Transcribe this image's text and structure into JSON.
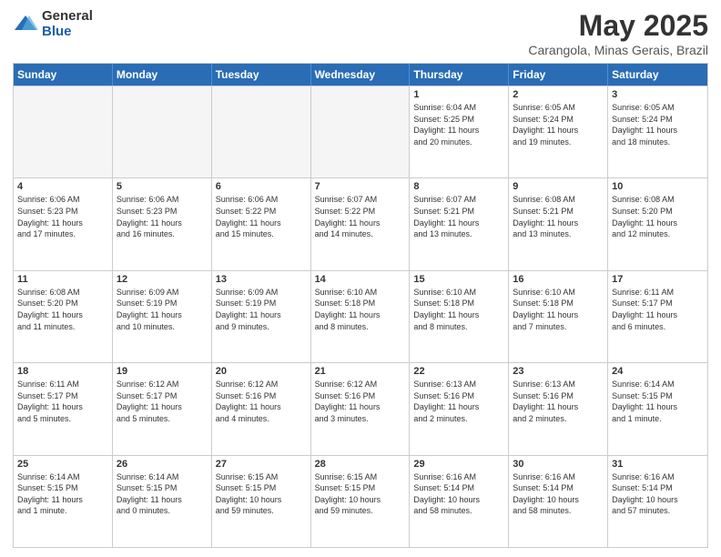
{
  "logo": {
    "general": "General",
    "blue": "Blue"
  },
  "title": "May 2025",
  "location": "Carangola, Minas Gerais, Brazil",
  "days_of_week": [
    "Sunday",
    "Monday",
    "Tuesday",
    "Wednesday",
    "Thursday",
    "Friday",
    "Saturday"
  ],
  "weeks": [
    [
      {
        "day": "",
        "info": "",
        "empty": true
      },
      {
        "day": "",
        "info": "",
        "empty": true
      },
      {
        "day": "",
        "info": "",
        "empty": true
      },
      {
        "day": "",
        "info": "",
        "empty": true
      },
      {
        "day": "1",
        "info": "Sunrise: 6:04 AM\nSunset: 5:25 PM\nDaylight: 11 hours\nand 20 minutes."
      },
      {
        "day": "2",
        "info": "Sunrise: 6:05 AM\nSunset: 5:24 PM\nDaylight: 11 hours\nand 19 minutes."
      },
      {
        "day": "3",
        "info": "Sunrise: 6:05 AM\nSunset: 5:24 PM\nDaylight: 11 hours\nand 18 minutes."
      }
    ],
    [
      {
        "day": "4",
        "info": "Sunrise: 6:06 AM\nSunset: 5:23 PM\nDaylight: 11 hours\nand 17 minutes."
      },
      {
        "day": "5",
        "info": "Sunrise: 6:06 AM\nSunset: 5:23 PM\nDaylight: 11 hours\nand 16 minutes."
      },
      {
        "day": "6",
        "info": "Sunrise: 6:06 AM\nSunset: 5:22 PM\nDaylight: 11 hours\nand 15 minutes."
      },
      {
        "day": "7",
        "info": "Sunrise: 6:07 AM\nSunset: 5:22 PM\nDaylight: 11 hours\nand 14 minutes."
      },
      {
        "day": "8",
        "info": "Sunrise: 6:07 AM\nSunset: 5:21 PM\nDaylight: 11 hours\nand 13 minutes."
      },
      {
        "day": "9",
        "info": "Sunrise: 6:08 AM\nSunset: 5:21 PM\nDaylight: 11 hours\nand 13 minutes."
      },
      {
        "day": "10",
        "info": "Sunrise: 6:08 AM\nSunset: 5:20 PM\nDaylight: 11 hours\nand 12 minutes."
      }
    ],
    [
      {
        "day": "11",
        "info": "Sunrise: 6:08 AM\nSunset: 5:20 PM\nDaylight: 11 hours\nand 11 minutes."
      },
      {
        "day": "12",
        "info": "Sunrise: 6:09 AM\nSunset: 5:19 PM\nDaylight: 11 hours\nand 10 minutes."
      },
      {
        "day": "13",
        "info": "Sunrise: 6:09 AM\nSunset: 5:19 PM\nDaylight: 11 hours\nand 9 minutes."
      },
      {
        "day": "14",
        "info": "Sunrise: 6:10 AM\nSunset: 5:18 PM\nDaylight: 11 hours\nand 8 minutes."
      },
      {
        "day": "15",
        "info": "Sunrise: 6:10 AM\nSunset: 5:18 PM\nDaylight: 11 hours\nand 8 minutes."
      },
      {
        "day": "16",
        "info": "Sunrise: 6:10 AM\nSunset: 5:18 PM\nDaylight: 11 hours\nand 7 minutes."
      },
      {
        "day": "17",
        "info": "Sunrise: 6:11 AM\nSunset: 5:17 PM\nDaylight: 11 hours\nand 6 minutes."
      }
    ],
    [
      {
        "day": "18",
        "info": "Sunrise: 6:11 AM\nSunset: 5:17 PM\nDaylight: 11 hours\nand 5 minutes."
      },
      {
        "day": "19",
        "info": "Sunrise: 6:12 AM\nSunset: 5:17 PM\nDaylight: 11 hours\nand 5 minutes."
      },
      {
        "day": "20",
        "info": "Sunrise: 6:12 AM\nSunset: 5:16 PM\nDaylight: 11 hours\nand 4 minutes."
      },
      {
        "day": "21",
        "info": "Sunrise: 6:12 AM\nSunset: 5:16 PM\nDaylight: 11 hours\nand 3 minutes."
      },
      {
        "day": "22",
        "info": "Sunrise: 6:13 AM\nSunset: 5:16 PM\nDaylight: 11 hours\nand 2 minutes."
      },
      {
        "day": "23",
        "info": "Sunrise: 6:13 AM\nSunset: 5:16 PM\nDaylight: 11 hours\nand 2 minutes."
      },
      {
        "day": "24",
        "info": "Sunrise: 6:14 AM\nSunset: 5:15 PM\nDaylight: 11 hours\nand 1 minute."
      }
    ],
    [
      {
        "day": "25",
        "info": "Sunrise: 6:14 AM\nSunset: 5:15 PM\nDaylight: 11 hours\nand 1 minute."
      },
      {
        "day": "26",
        "info": "Sunrise: 6:14 AM\nSunset: 5:15 PM\nDaylight: 11 hours\nand 0 minutes."
      },
      {
        "day": "27",
        "info": "Sunrise: 6:15 AM\nSunset: 5:15 PM\nDaylight: 10 hours\nand 59 minutes."
      },
      {
        "day": "28",
        "info": "Sunrise: 6:15 AM\nSunset: 5:15 PM\nDaylight: 10 hours\nand 59 minutes."
      },
      {
        "day": "29",
        "info": "Sunrise: 6:16 AM\nSunset: 5:14 PM\nDaylight: 10 hours\nand 58 minutes."
      },
      {
        "day": "30",
        "info": "Sunrise: 6:16 AM\nSunset: 5:14 PM\nDaylight: 10 hours\nand 58 minutes."
      },
      {
        "day": "31",
        "info": "Sunrise: 6:16 AM\nSunset: 5:14 PM\nDaylight: 10 hours\nand 57 minutes."
      }
    ]
  ]
}
